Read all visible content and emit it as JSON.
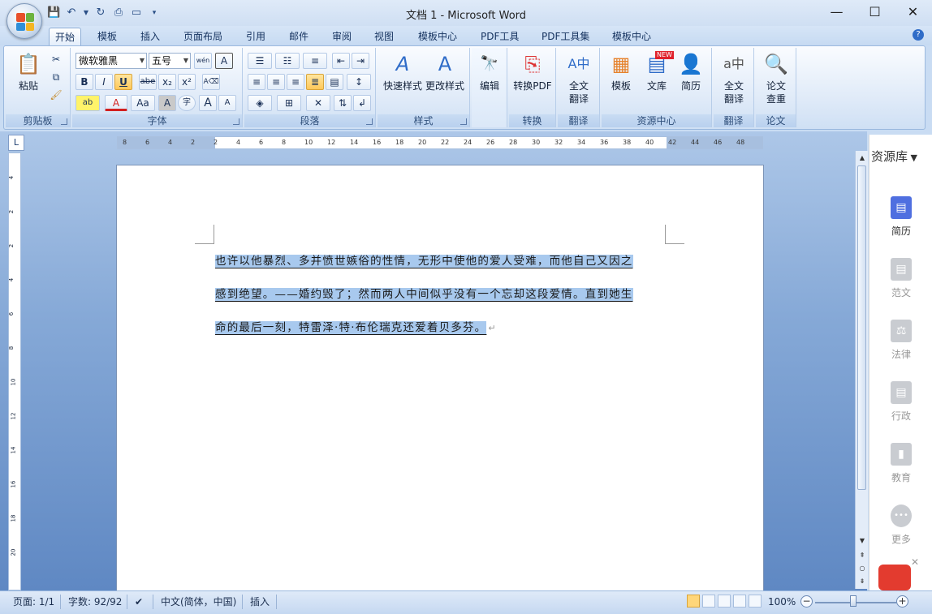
{
  "window": {
    "title": "文档 1 - Microsoft Word",
    "controls": {
      "minimize": "—",
      "maximize": "☐",
      "close": "✕"
    }
  },
  "tabs": [
    "开始",
    "模板",
    "插入",
    "页面布局",
    "引用",
    "邮件",
    "审阅",
    "视图",
    "模板中心",
    "PDF工具",
    "PDF工具集",
    "模板中心"
  ],
  "ribbon": {
    "clipboard": {
      "paste": "粘贴",
      "label": "剪贴板"
    },
    "font": {
      "font_name": "微软雅黑",
      "font_size": "五号",
      "label": "字体",
      "bold": "B",
      "italic": "I",
      "underline": "U",
      "strike": "abe",
      "subscript": "x₂",
      "superscript": "x²",
      "highlight": "ab",
      "font_color": "A",
      "change_case": "Aa",
      "char_shade": "A",
      "enclose": "字",
      "grow": "A",
      "shrink": "A",
      "phonetic": "wén",
      "border": "A"
    },
    "paragraph": {
      "label": "段落"
    },
    "styles": {
      "quick_styles": "快速样式",
      "change_styles": "更改样式",
      "label": "样式",
      "glyph": "A"
    },
    "editing": {
      "label": "编辑",
      "icon_glyph": "🔭"
    },
    "convert": {
      "to_pdf": "转换PDF",
      "label": "转换"
    },
    "translate": {
      "full_line1": "全文",
      "full_line2": "翻译",
      "label": "翻译"
    },
    "resources": {
      "template": "模板",
      "library": "文库",
      "resume": "简历",
      "new_badge": "NEW",
      "label": "资源中心"
    },
    "translate2": {
      "line1": "全文",
      "line2": "翻译",
      "label": "翻译"
    },
    "thesis": {
      "line1": "论文",
      "line2": "查重",
      "label": "论文"
    }
  },
  "ruler": {
    "h_ticks": [
      "8",
      "6",
      "4",
      "2",
      "2",
      "4",
      "6",
      "8",
      "10",
      "12",
      "14",
      "16",
      "18",
      "20",
      "22",
      "24",
      "26",
      "28",
      "30",
      "32",
      "34",
      "36",
      "38",
      "40",
      "42",
      "44",
      "46",
      "48"
    ],
    "v_ticks": [
      "4",
      "2",
      "2",
      "4",
      "6",
      "8",
      "10",
      "12",
      "14",
      "16",
      "18",
      "20"
    ]
  },
  "document": {
    "lines": [
      "也许以他暴烈、多并愤世嫉俗的性情，无形中使他的爱人受难，而他自己又因之",
      "感到绝望。——婚约毁了；然而两人中间似乎没有一个忘却这段爱情。直到她生",
      "命的最后一刻，特雷泽·特·布伦瑞克还爱着贝多芬。"
    ],
    "para_mark": "↵"
  },
  "resource_panel": {
    "title": "资源库",
    "items": [
      {
        "label": "简历",
        "glyph": "▤"
      },
      {
        "label": "范文",
        "glyph": "▤"
      },
      {
        "label": "法律",
        "glyph": "⚖"
      },
      {
        "label": "行政",
        "glyph": "▤"
      },
      {
        "label": "教育",
        "glyph": "▮"
      },
      {
        "label": "更多",
        "glyph": "•••"
      }
    ]
  },
  "statusbar": {
    "page": "页面: 1/1",
    "words": "字数: 92/92",
    "language": "中文(简体，中国)",
    "mode": "插入",
    "zoom": "100%"
  },
  "colors": {
    "selection": "#a8c9ee",
    "accent": "#2f6cc8",
    "ribbon_bg": "#dfeaf8"
  }
}
